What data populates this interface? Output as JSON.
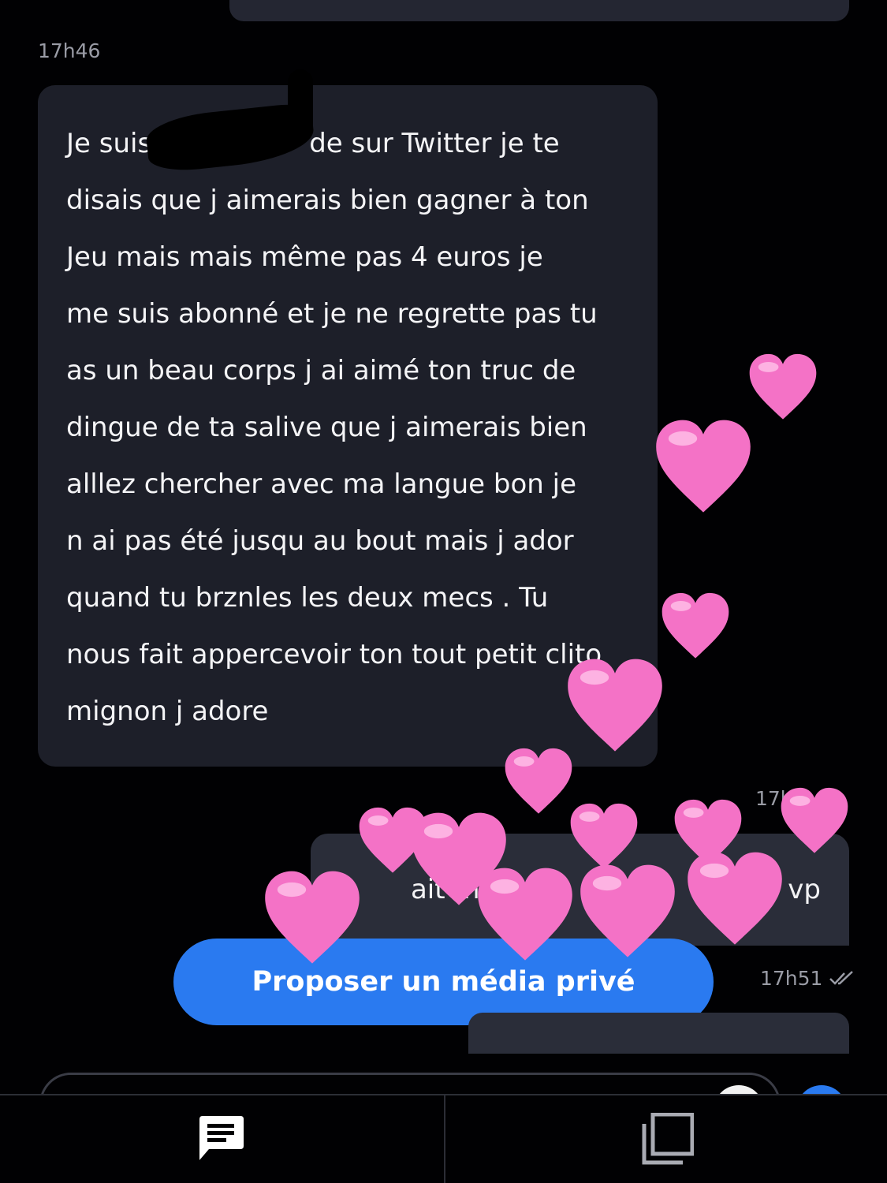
{
  "conversation": {
    "timestamp_1": "17h46",
    "incoming_message_lines": [
      "Je suis",
      "de sur Twitter je te",
      "disais que j aimerais bien gagner à ton",
      "Jeu mais mais même pas 4 euros je",
      "me suis abonné et je ne regrette pas tu",
      "as un beau corps j ai aimé ton truc de",
      "dingue de ta salive que j aimerais bien",
      "alllez chercher avec ma langue bon je",
      "n ai pas été jusqu au bout mais j ador",
      "quand tu brznles les deux mecs . Tu",
      "nous fait appercevoir ton tout petit clito",
      "mignon j adore"
    ],
    "timestamp_2": "17h",
    "outgoing_fragments": [
      "ait mo",
      "vp"
    ],
    "timestamp_3": "17h51",
    "read_icon": "double-check-icon",
    "private_media_button": "Proposer un média privé"
  },
  "bottom_nav": {
    "tabs": [
      {
        "icon": "chat-icon",
        "active": true
      },
      {
        "icon": "media-icon",
        "active": false
      }
    ]
  },
  "colors": {
    "background": "#010103",
    "incoming_bubble": "#1d1f29",
    "outgoing_bubble": "#2a2d39",
    "accent": "#2a7af0",
    "heart": "#f472c6"
  }
}
